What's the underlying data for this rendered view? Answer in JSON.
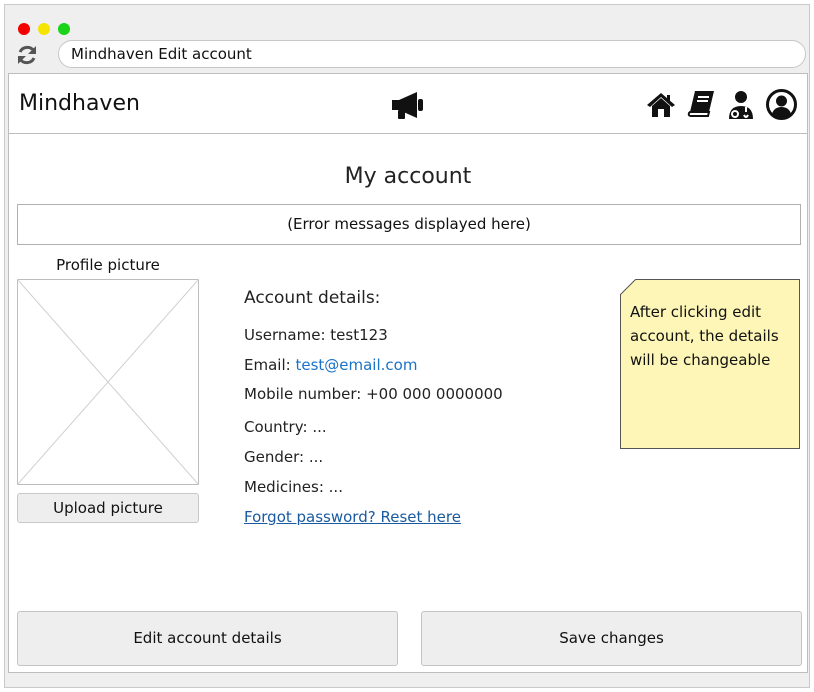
{
  "browser": {
    "address": "Mindhaven Edit account"
  },
  "navbar": {
    "brand": "Mindhaven",
    "icons": [
      "megaphone-icon",
      "home-icon",
      "book-icon",
      "doctor-icon",
      "user-icon"
    ]
  },
  "page": {
    "title": "My account",
    "error_message": "(Error messages displayed here)"
  },
  "profile": {
    "label": "Profile picture",
    "upload_label": "Upload picture"
  },
  "account": {
    "heading": "Account details:",
    "username_label": "Username: ",
    "username": "test123",
    "email_label": "Email: ",
    "email": "test@email.com",
    "mobile_label": "Mobile number: ",
    "mobile": "+00 000 0000000",
    "country_label": "Country: ",
    "country": "...",
    "gender_label": "Gender: ",
    "gender": "...",
    "medicines_label": "Medicines: ",
    "medicines": "...",
    "reset_link": "Forgot password? Reset here"
  },
  "note": {
    "text": "After clicking edit account, the details will be changeable"
  },
  "actions": {
    "edit_label": "Edit account details",
    "save_label": "Save changes"
  },
  "colors": {
    "note_bg": "#fdf6b6",
    "link": "#1a73c8",
    "button_bg": "#eeeeee"
  }
}
